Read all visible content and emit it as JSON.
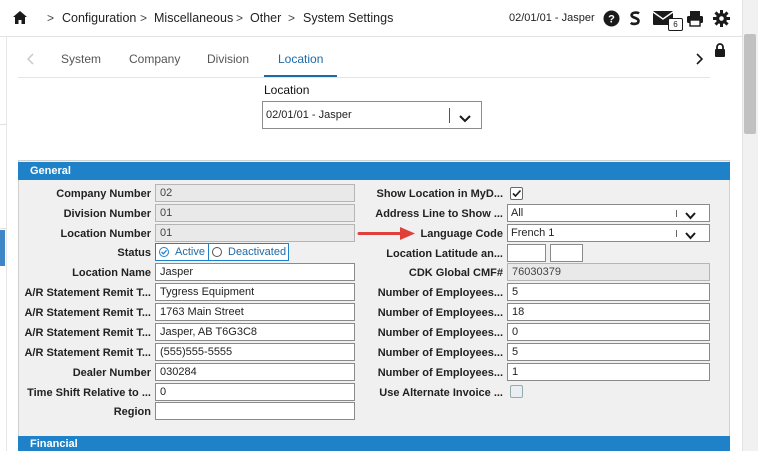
{
  "breadcrumb": {
    "items": [
      "Configuration",
      "Miscellaneous",
      "Other",
      "System Settings"
    ],
    "separator": ">"
  },
  "header": {
    "context": "02/01/01 - Jasper",
    "mail_count": "6"
  },
  "tabs": [
    {
      "label": "System"
    },
    {
      "label": "Company"
    },
    {
      "label": "Division"
    },
    {
      "label": "Location"
    }
  ],
  "location_picker": {
    "label": "Location",
    "value": "02/01/01 - Jasper"
  },
  "sections": {
    "general": "General",
    "financial": "Financial"
  },
  "left_fields": {
    "company_number": {
      "label": "Company Number",
      "value": "02"
    },
    "division_number": {
      "label": "Division Number",
      "value": "01"
    },
    "location_number": {
      "label": "Location Number",
      "value": "01"
    },
    "status": {
      "label": "Status",
      "options": [
        "Active",
        "Deactivated"
      ],
      "selected": "Active"
    },
    "location_name": {
      "label": "Location Name",
      "value": "Jasper"
    },
    "ar_remit_1": {
      "label": "A/R Statement Remit T...",
      "value": "Tygress Equipment"
    },
    "ar_remit_2": {
      "label": "A/R Statement Remit T...",
      "value": "1763 Main Street"
    },
    "ar_remit_3": {
      "label": "A/R Statement Remit T...",
      "value": "Jasper, AB T6G3C8"
    },
    "ar_remit_4": {
      "label": "A/R Statement Remit T...",
      "value": "(555)555-5555"
    },
    "dealer_number": {
      "label": "Dealer Number",
      "value": "030284"
    },
    "time_shift": {
      "label": "Time Shift Relative to ...",
      "value": "0"
    },
    "region": {
      "label": "Region",
      "value": ""
    }
  },
  "right_fields": {
    "show_location": {
      "label": "Show Location in MyD...",
      "checked": true
    },
    "address_line": {
      "label": "Address Line to Show ...",
      "value": "All"
    },
    "language_code": {
      "label": "Language Code",
      "value": "French 1"
    },
    "lat_long": {
      "label": "Location Latitude an...",
      "lat": "",
      "long": ""
    },
    "cdk_global": {
      "label": "CDK Global CMF#",
      "value": "76030379"
    },
    "employees_1": {
      "label": "Number of Employees...",
      "value": "5"
    },
    "employees_2": {
      "label": "Number of Employees...",
      "value": "18"
    },
    "employees_3": {
      "label": "Number of Employees...",
      "value": "0"
    },
    "employees_4": {
      "label": "Number of Employees...",
      "value": "5"
    },
    "employees_5": {
      "label": "Number of Employees...",
      "value": "1"
    },
    "alt_invoice": {
      "label": "Use Alternate Invoice ...",
      "checked": false
    }
  },
  "colors": {
    "accent": "#1f82c9",
    "annotation_arrow": "#e0403a"
  }
}
